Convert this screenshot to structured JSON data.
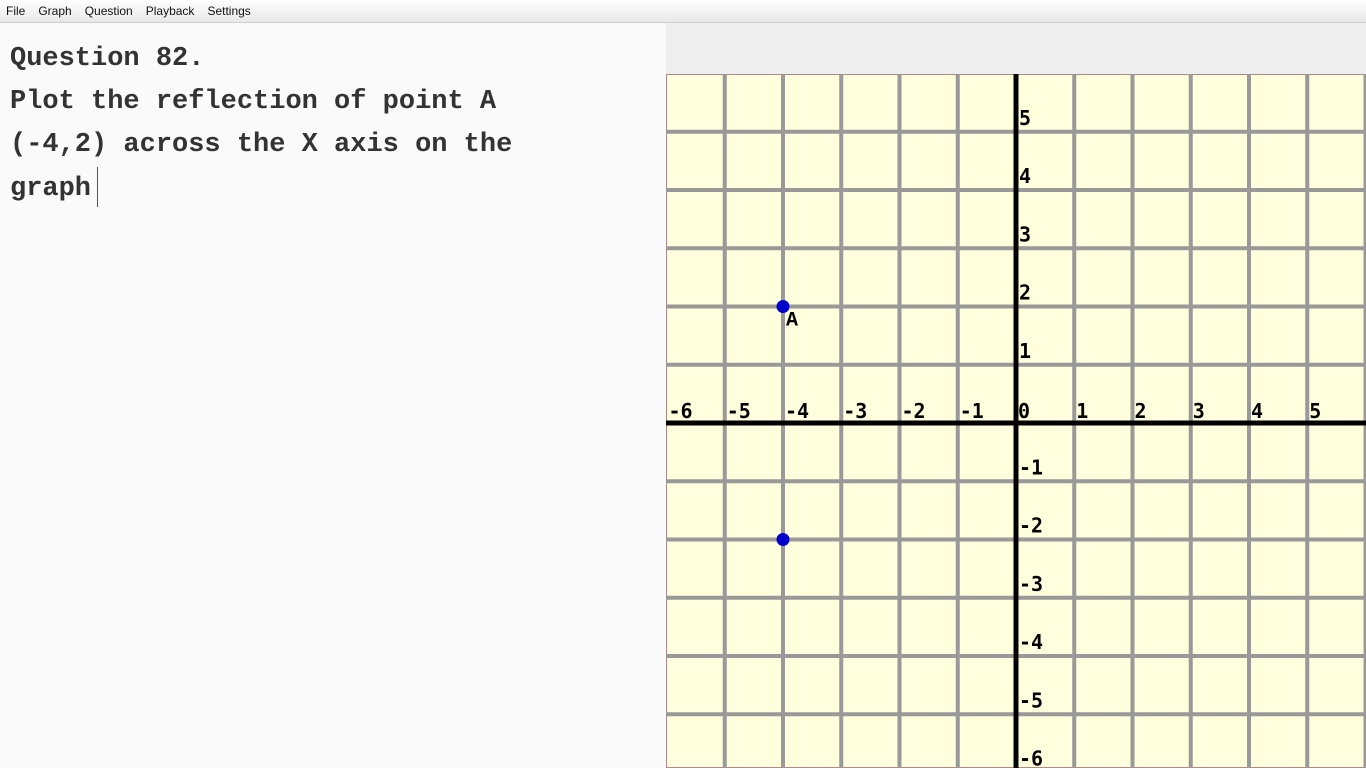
{
  "menu": [
    "File",
    "Graph",
    "Question",
    "Playback",
    "Settings"
  ],
  "question": {
    "line1": "Question 82.",
    "line2": "Plot the reflection of point A",
    "line3": "(-4,2) across the X axis on the",
    "line4": "graph"
  },
  "graph": {
    "x_range": [
      -6,
      6
    ],
    "y_range": [
      -6,
      6
    ],
    "x_tick_labels": [
      "-6",
      "-5",
      "-4",
      "-3",
      "-2",
      "-1",
      "0",
      "1",
      "2",
      "3",
      "4",
      "5"
    ],
    "y_tick_labels": [
      "5",
      "4",
      "3",
      "2",
      "1",
      "-1",
      "-2",
      "-3",
      "-4",
      "-5",
      "-6"
    ],
    "background_color": "#ffffdd",
    "grid_color": "#999999",
    "axis_color": "#000000",
    "point_color": "#0000cc",
    "points": [
      {
        "label": "A",
        "x": -4,
        "y": 2
      },
      {
        "label": "",
        "x": -4,
        "y": -2
      }
    ]
  }
}
